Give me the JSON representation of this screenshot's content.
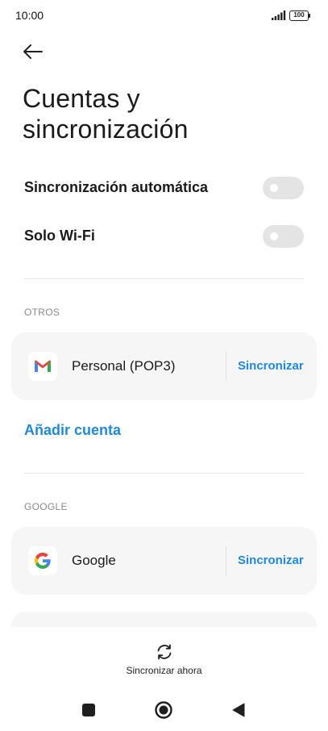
{
  "status_bar": {
    "time": "10:00",
    "battery": "100",
    "icons": [
      "signal-icon",
      "battery-icon"
    ]
  },
  "header": {
    "back_icon": "arrow-left-icon",
    "title": "Cuentas y sincronización"
  },
  "settings": {
    "auto_sync": {
      "label": "Sincronización automática",
      "enabled": false
    },
    "wifi_only": {
      "label": "Solo Wi-Fi",
      "enabled": false
    }
  },
  "sections": {
    "otros": {
      "header": "OTROS",
      "account": {
        "name": "Personal (POP3)",
        "icon": "gmail-icon",
        "action": "Sincronizar"
      },
      "add_account": "Añadir cuenta"
    },
    "google": {
      "header": "GOOGLE",
      "account": {
        "name": "Google",
        "icon": "google-icon",
        "action": "Sincronizar"
      }
    }
  },
  "bottom": {
    "sync_now_label": "Sincronizar ahora",
    "sync_now_icon": "sync-icon"
  },
  "nav": {
    "icons": [
      "recent-apps-icon",
      "home-icon",
      "back-icon"
    ]
  },
  "colors": {
    "accent": "#1e88e5",
    "card": "#f6f6f6",
    "toggle_off": "#e4e4e4",
    "gmail_red": "#ea4335"
  }
}
